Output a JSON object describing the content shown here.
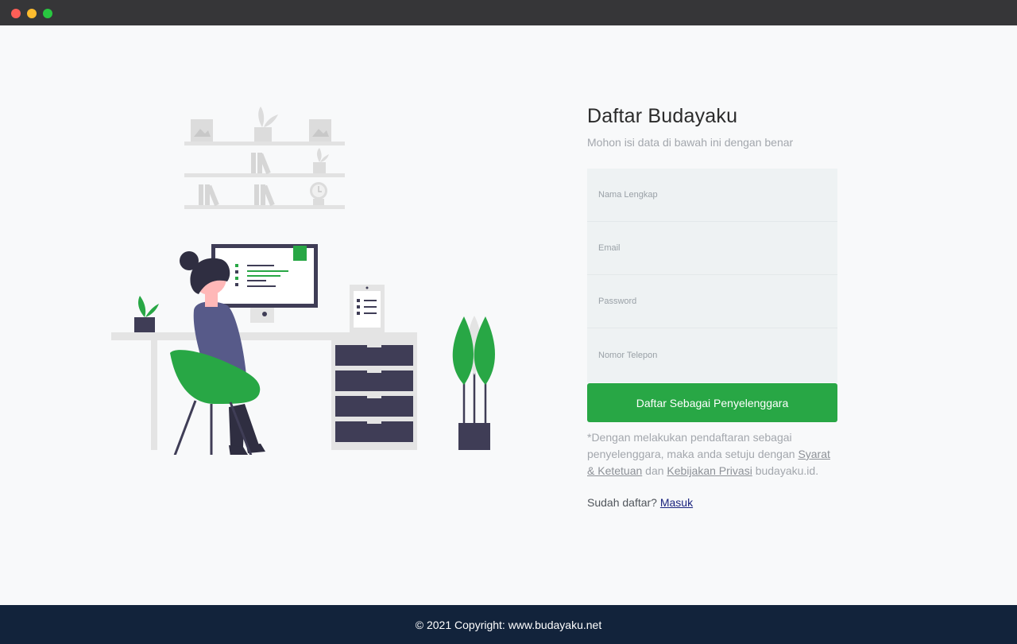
{
  "window": {
    "controls": [
      "close-icon",
      "minimize-icon",
      "maximize-icon"
    ],
    "colors": {
      "close": "#fe5f57",
      "minimize": "#febc2e",
      "maximize": "#28c840",
      "titlebar": "#363638"
    }
  },
  "form": {
    "title": "Daftar Budayaku",
    "subtitle": "Mohon isi data di bawah ini dengan benar",
    "fields": [
      {
        "placeholder": "Nama Lengkap",
        "value": ""
      },
      {
        "placeholder": "Email",
        "value": ""
      },
      {
        "placeholder": "Password",
        "value": ""
      },
      {
        "placeholder": "Nomor Telepon",
        "value": ""
      }
    ],
    "submit_label": "Daftar Sebagai Penyelenggara",
    "terms_prefix": "*Dengan melakukan pendaftaran sebagai penyelenggara, maka anda setuju dengan",
    "terms_link": "Syarat & Ketetuan",
    "terms_and": "dan",
    "privacy_link": "Kebijakan Privasi",
    "terms_suffix": "budayaku.id.",
    "login_prompt": "Sudah daftar?",
    "login_link": "Masuk"
  },
  "footer": {
    "text": "© 2021 Copyright: www.budayaku.net"
  },
  "colors": {
    "accent": "#28a745",
    "footer_bg": "#12233b",
    "field_bg": "#eef2f3",
    "link": "#1a237e"
  }
}
